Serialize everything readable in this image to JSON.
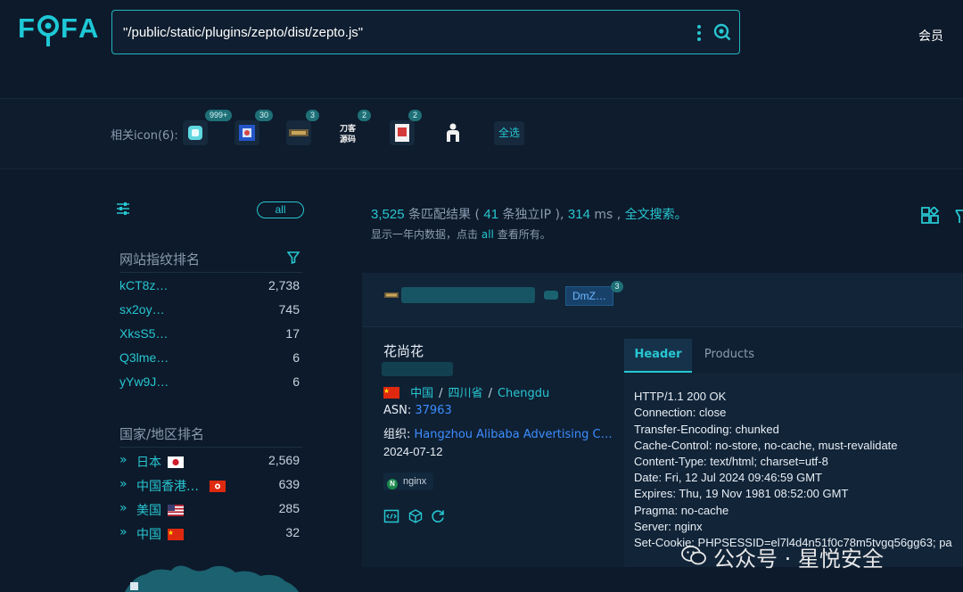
{
  "brand": {
    "logo_text": "FOFA",
    "accent": "#27c6d1",
    "bg": "#0d1a2b"
  },
  "search": {
    "query": "\"/public/static/plugins/zepto/dist/zepto.js\""
  },
  "header": {
    "member_label": "会员"
  },
  "related_icons": {
    "label": "相关icon(6):",
    "items": [
      {
        "icon": "teal-square-icon",
        "badge": "999+"
      },
      {
        "icon": "blue-square-icon",
        "badge": "30"
      },
      {
        "icon": "dark-logo-icon",
        "badge": "3"
      },
      {
        "icon": "daoke-logo-icon",
        "badge": "2",
        "glyph": "刀客源码"
      },
      {
        "icon": "red-logo-icon",
        "badge": "2"
      },
      {
        "icon": "person-icon",
        "badge": ""
      }
    ],
    "select_all": "全选"
  },
  "sidebar": {
    "all_label": "all",
    "fingerprint_title": "网站指纹排名",
    "fingerprints": [
      {
        "name": "kCT8z…",
        "count": "2,738"
      },
      {
        "name": "sx2oy…",
        "count": "745"
      },
      {
        "name": "XksS5…",
        "count": "17"
      },
      {
        "name": "Q3lme…",
        "count": "6"
      },
      {
        "name": "yYw9J…",
        "count": "6"
      }
    ],
    "country_title": "国家/地区排名",
    "countries": [
      {
        "name": "日本",
        "count": "2,569",
        "flag": "jp"
      },
      {
        "name": "中国香港…",
        "count": "639",
        "flag": "hk"
      },
      {
        "name": "美国",
        "count": "285",
        "flag": "us"
      },
      {
        "name": "中国",
        "count": "32",
        "flag": "cn"
      }
    ]
  },
  "stats": {
    "results": "3,525",
    "results_label": "条匹配结果 (",
    "ips": "41",
    "ips_label": "条独立IP ),",
    "ms": "314",
    "ms_label": "ms ,",
    "fulltext": "全文搜索。",
    "sub_prefix": "显示一年内数据，点击",
    "sub_all": "all",
    "sub_suffix": "查看所有。"
  },
  "result": {
    "dmz_label": "DmZ…",
    "dmz_badge": "3",
    "host_title": "花尚花",
    "country": "中国",
    "province": "四川省",
    "city": "Chengdu",
    "asn_label": "ASN:",
    "asn": "37963",
    "org_label": "组织:",
    "org": "Hangzhou Alibaba Advertising C…",
    "date": "2024-07-12",
    "server_tag": "nginx",
    "server_tag_glyph": "N",
    "tabs": {
      "header": "Header",
      "products": "Products"
    },
    "header_lines": [
      "HTTP/1.1 200 OK",
      "Connection: close",
      "Transfer-Encoding: chunked",
      "Cache-Control: no-store, no-cache, must-revalidate",
      "Content-Type: text/html; charset=utf-8",
      "Date: Fri, 12 Jul 2024 09:46:59 GMT",
      "Expires: Thu, 19 Nov 1981 08:52:00 GMT",
      "Pragma: no-cache",
      "Server: nginx",
      "Set-Cookie: PHPSESSID=el7l4d4n51f0c78m5tvgq56gg63; pa"
    ]
  },
  "watermark": {
    "text": "公众号 · 星悦安全"
  }
}
